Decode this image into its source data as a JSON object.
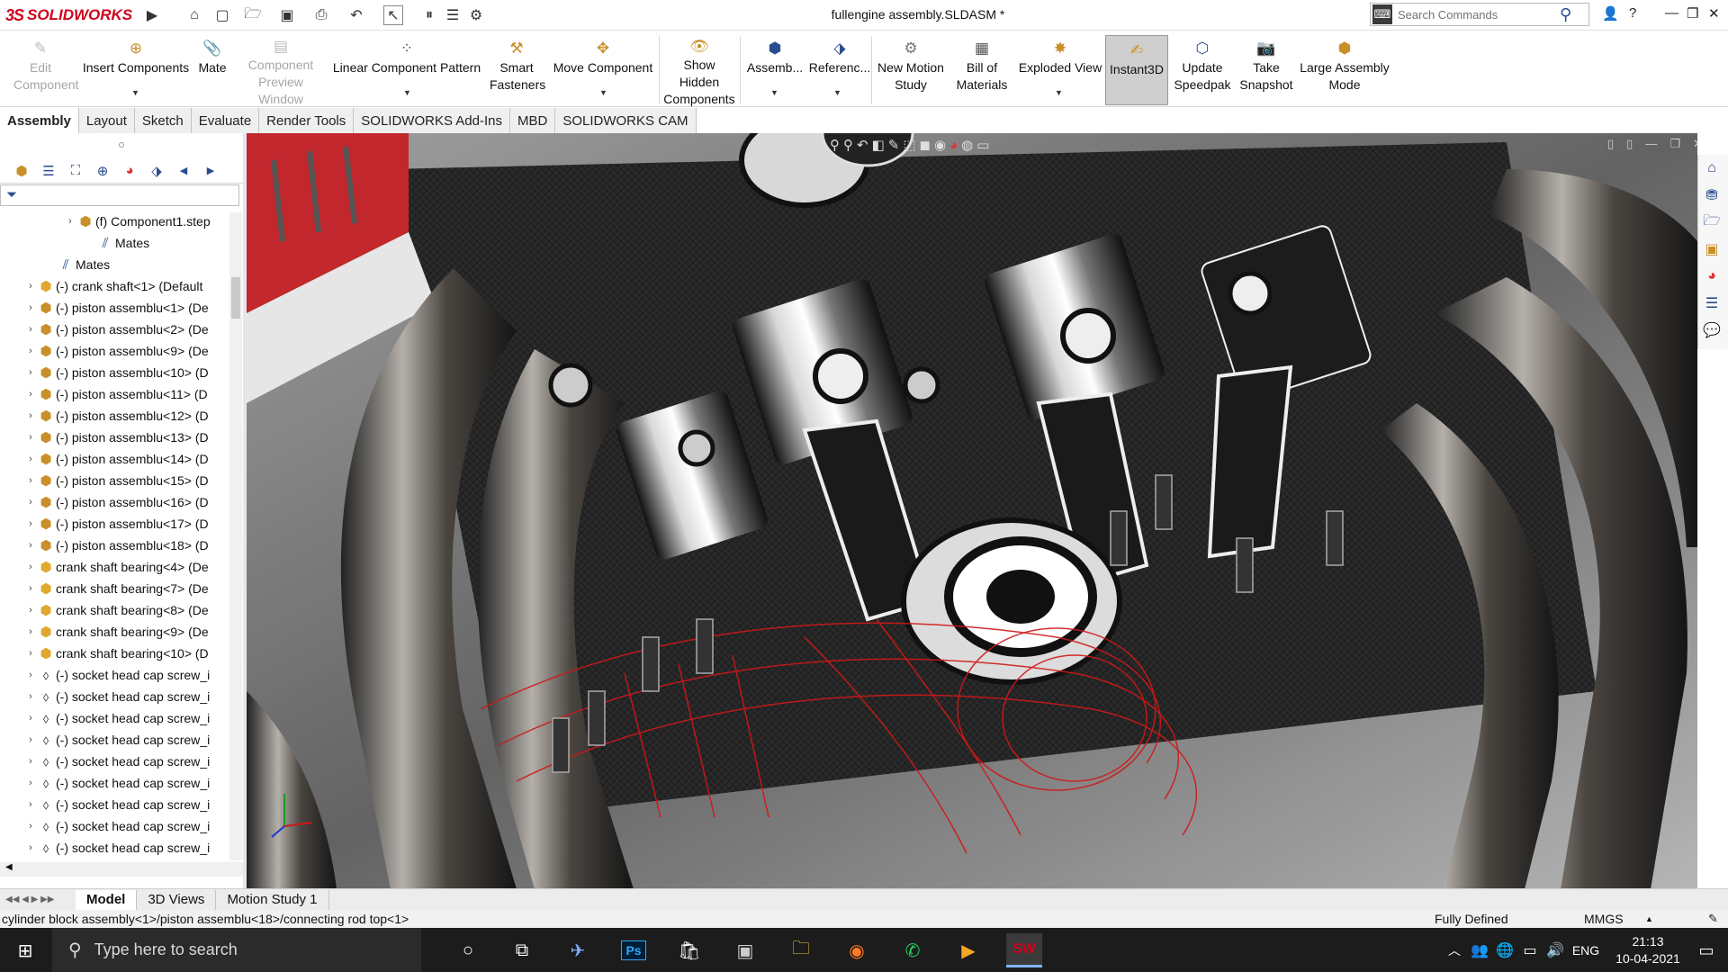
{
  "app": {
    "name": "SOLIDWORKS",
    "logo_prefix": "3S",
    "doc_title": "fullengine assembly.SLDASM *"
  },
  "search": {
    "placeholder": "Search Commands"
  },
  "ribbon": {
    "edit_component": "Edit Component",
    "insert_components": "Insert Components",
    "mate": "Mate",
    "component_preview": "Component Preview Window",
    "linear_pattern": "Linear Component Pattern",
    "smart_fasteners": "Smart Fasteners",
    "move_component": "Move Component",
    "show_hidden": "Show Hidden Components",
    "assemb": "Assemb...",
    "referenc": "Referenc...",
    "new_motion": "New Motion Study",
    "bill_of_materials": "Bill of Materials",
    "exploded_view": "Exploded View",
    "instant3d": "Instant3D",
    "update_speedpak": "Update Speedpak",
    "take_snapshot": "Take Snapshot",
    "large_assembly": "Large Assembly Mode"
  },
  "tabs": [
    "Assembly",
    "Layout",
    "Sketch",
    "Evaluate",
    "Render Tools",
    "SOLIDWORKS Add-Ins",
    "MBD",
    "SOLIDWORKS CAM"
  ],
  "tree": [
    {
      "label": "(f) Component1.step",
      "indent": 3,
      "icon": "assembly",
      "toggle": true
    },
    {
      "label": "Mates",
      "indent": 4,
      "icon": "mates",
      "toggle": false
    },
    {
      "label": "Mates",
      "indent": 2,
      "icon": "mates",
      "toggle": false
    },
    {
      "label": "(-) crank shaft<1> (Default",
      "indent": 1,
      "icon": "part",
      "toggle": true
    },
    {
      "label": "(-) piston assemblu<1> (De",
      "indent": 1,
      "icon": "assembly",
      "toggle": true
    },
    {
      "label": "(-) piston assemblu<2> (De",
      "indent": 1,
      "icon": "assembly",
      "toggle": true
    },
    {
      "label": "(-) piston assemblu<9> (De",
      "indent": 1,
      "icon": "assembly",
      "toggle": true
    },
    {
      "label": "(-) piston assemblu<10> (D",
      "indent": 1,
      "icon": "assembly",
      "toggle": true
    },
    {
      "label": "(-) piston assemblu<11> (D",
      "indent": 1,
      "icon": "assembly",
      "toggle": true
    },
    {
      "label": "(-) piston assemblu<12> (D",
      "indent": 1,
      "icon": "assembly",
      "toggle": true
    },
    {
      "label": "(-) piston assemblu<13> (D",
      "indent": 1,
      "icon": "assembly",
      "toggle": true
    },
    {
      "label": "(-) piston assemblu<14> (D",
      "indent": 1,
      "icon": "assembly",
      "toggle": true
    },
    {
      "label": "(-) piston assemblu<15> (D",
      "indent": 1,
      "icon": "assembly",
      "toggle": true
    },
    {
      "label": "(-) piston assemblu<16> (D",
      "indent": 1,
      "icon": "assembly",
      "toggle": true
    },
    {
      "label": "(-) piston assemblu<17> (D",
      "indent": 1,
      "icon": "assembly",
      "toggle": true
    },
    {
      "label": "(-) piston assemblu<18> (D",
      "indent": 1,
      "icon": "assembly",
      "toggle": true
    },
    {
      "label": "crank shaft bearing<4> (De",
      "indent": 1,
      "icon": "part",
      "toggle": true
    },
    {
      "label": "crank shaft bearing<7> (De",
      "indent": 1,
      "icon": "part",
      "toggle": true
    },
    {
      "label": "crank shaft bearing<8> (De",
      "indent": 1,
      "icon": "part",
      "toggle": true
    },
    {
      "label": "crank shaft bearing<9> (De",
      "indent": 1,
      "icon": "part",
      "toggle": true
    },
    {
      "label": "crank shaft bearing<10> (D",
      "indent": 1,
      "icon": "part",
      "toggle": true
    },
    {
      "label": "(-) socket head cap screw_i",
      "indent": 1,
      "icon": "screw",
      "toggle": true
    },
    {
      "label": "(-) socket head cap screw_i",
      "indent": 1,
      "icon": "screw",
      "toggle": true
    },
    {
      "label": "(-) socket head cap screw_i",
      "indent": 1,
      "icon": "screw",
      "toggle": true
    },
    {
      "label": "(-) socket head cap screw_i",
      "indent": 1,
      "icon": "screw",
      "toggle": true
    },
    {
      "label": "(-) socket head cap screw_i",
      "indent": 1,
      "icon": "screw",
      "toggle": true
    },
    {
      "label": "(-) socket head cap screw_i",
      "indent": 1,
      "icon": "screw",
      "toggle": true
    },
    {
      "label": "(-) socket head cap screw_i",
      "indent": 1,
      "icon": "screw",
      "toggle": true
    },
    {
      "label": "(-) socket head cap screw_i",
      "indent": 1,
      "icon": "screw",
      "toggle": true
    },
    {
      "label": "(-) socket head cap screw_i",
      "indent": 1,
      "icon": "screw",
      "toggle": true
    }
  ],
  "bottom_tabs": [
    "Model",
    "3D Views",
    "Motion Study 1"
  ],
  "status": {
    "path": "cylinder block assembly<1>/piston assemblu<18>/connecting rod top<1>",
    "state": "Fully Defined",
    "units": "MMGS"
  },
  "taskbar": {
    "search_placeholder": "Type here to search",
    "lang": "ENG",
    "time": "21:13",
    "date": "10-04-2021"
  },
  "colors": {
    "brand": "#d0021b",
    "accent": "#2a4b8d",
    "ribbon_icon": "#c8902a"
  }
}
